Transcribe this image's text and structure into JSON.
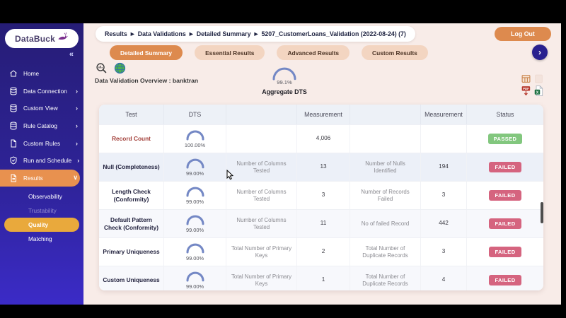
{
  "chrome": {
    "logout_label": "Log Out",
    "collapse_glyph": "«",
    "next_glyph": "›"
  },
  "sidebar": {
    "logo_text": "DataBuck",
    "items": [
      {
        "label": "Home",
        "icon": "home-icon",
        "chevron": ""
      },
      {
        "label": "Data Connection",
        "icon": "database-icon",
        "chevron": "›"
      },
      {
        "label": "Custom View",
        "icon": "database-icon",
        "chevron": "›"
      },
      {
        "label": "Rule Catalog",
        "icon": "database-icon",
        "chevron": "›"
      },
      {
        "label": "Custom Rules",
        "icon": "document-icon",
        "chevron": "›"
      },
      {
        "label": "Run and Schedule",
        "icon": "shield-icon",
        "chevron": "›"
      },
      {
        "label": "Results",
        "icon": "report-icon",
        "chevron": "∨",
        "active": true
      }
    ],
    "sub_items": [
      {
        "label": "Observability",
        "state": "normal"
      },
      {
        "label": "Trustability",
        "state": "dim"
      },
      {
        "label": "Quality",
        "state": "active"
      },
      {
        "label": "Matching",
        "state": "normal"
      }
    ]
  },
  "breadcrumb": {
    "separator": "▶",
    "parts": [
      "Results",
      "Data Validations",
      "Detailed Summary",
      "5207_CustomerLoans_Validation (2022-08-24) (7)"
    ]
  },
  "tabs": [
    {
      "label": "Detailed Summary",
      "active": true
    },
    {
      "label": "Essential Results",
      "active": false
    },
    {
      "label": "Advanced Results",
      "active": false
    },
    {
      "label": "Custom Results",
      "active": false
    }
  ],
  "overview": {
    "title": "Data Validation Overview : banktran"
  },
  "aggregate": {
    "value_text": "99.1%",
    "percent": 99.1,
    "label": "Aggregate DTS"
  },
  "export_icons": [
    "table-export-icon",
    "sheet-disabled-icon",
    "pdf-download-icon",
    "excel-download-icon"
  ],
  "table": {
    "headers": [
      "Test",
      "DTS",
      "",
      "Measurement",
      "",
      "Measurement",
      "Status"
    ],
    "rows": [
      {
        "test": "Record Count",
        "alert": true,
        "dts_text": "100.00%",
        "dts_pct": 100,
        "m1_label": "",
        "m1_value": "4,006",
        "m2_label": "",
        "m2_value": "",
        "status": "PASSED"
      },
      {
        "test": "Null (Completeness)",
        "alert": false,
        "dts_text": "99.00%",
        "dts_pct": 99,
        "m1_label": "Number of Columns Tested",
        "m1_value": "13",
        "m2_label": "Number of Nulls Identified",
        "m2_value": "194",
        "status": "FAILED"
      },
      {
        "test": "Length Check (Conformity)",
        "alert": false,
        "dts_text": "99.00%",
        "dts_pct": 99,
        "m1_label": "Number of Columns Tested",
        "m1_value": "3",
        "m2_label": "Number of Records Failed",
        "m2_value": "3",
        "status": "FAILED"
      },
      {
        "test": "Default Pattern Check (Conformity)",
        "alert": false,
        "dts_text": "99.00%",
        "dts_pct": 99,
        "m1_label": "Number of Columns Tested",
        "m1_value": "11",
        "m2_label": "No of failed Record",
        "m2_value": "442",
        "status": "FAILED"
      },
      {
        "test": "Primary Uniqueness",
        "alert": false,
        "dts_text": "99.00%",
        "dts_pct": 99,
        "m1_label": "Total Number of Primary Keys",
        "m1_value": "2",
        "m2_label": "Total Number of Duplicate Records",
        "m2_value": "3",
        "status": "FAILED"
      },
      {
        "test": "Custom Uniqueness",
        "alert": false,
        "dts_text": "99.00%",
        "dts_pct": 99,
        "m1_label": "Total Number of Primary Keys",
        "m1_value": "1",
        "m2_label": "Total Number of Duplicate Records",
        "m2_value": "4",
        "status": "FAILED"
      }
    ]
  },
  "colors": {
    "accent_orange": "#dd8a4e",
    "tab_inactive": "#f3d5c1",
    "sidebar_active": "#e8914f",
    "quality_active": "#e9a93c",
    "passed_green": "#82c77e",
    "failed_red": "#d5647f",
    "gauge_blue": "#7488c5",
    "gauge_track": "#d4d9e4",
    "alert_test": "#a3403a"
  }
}
